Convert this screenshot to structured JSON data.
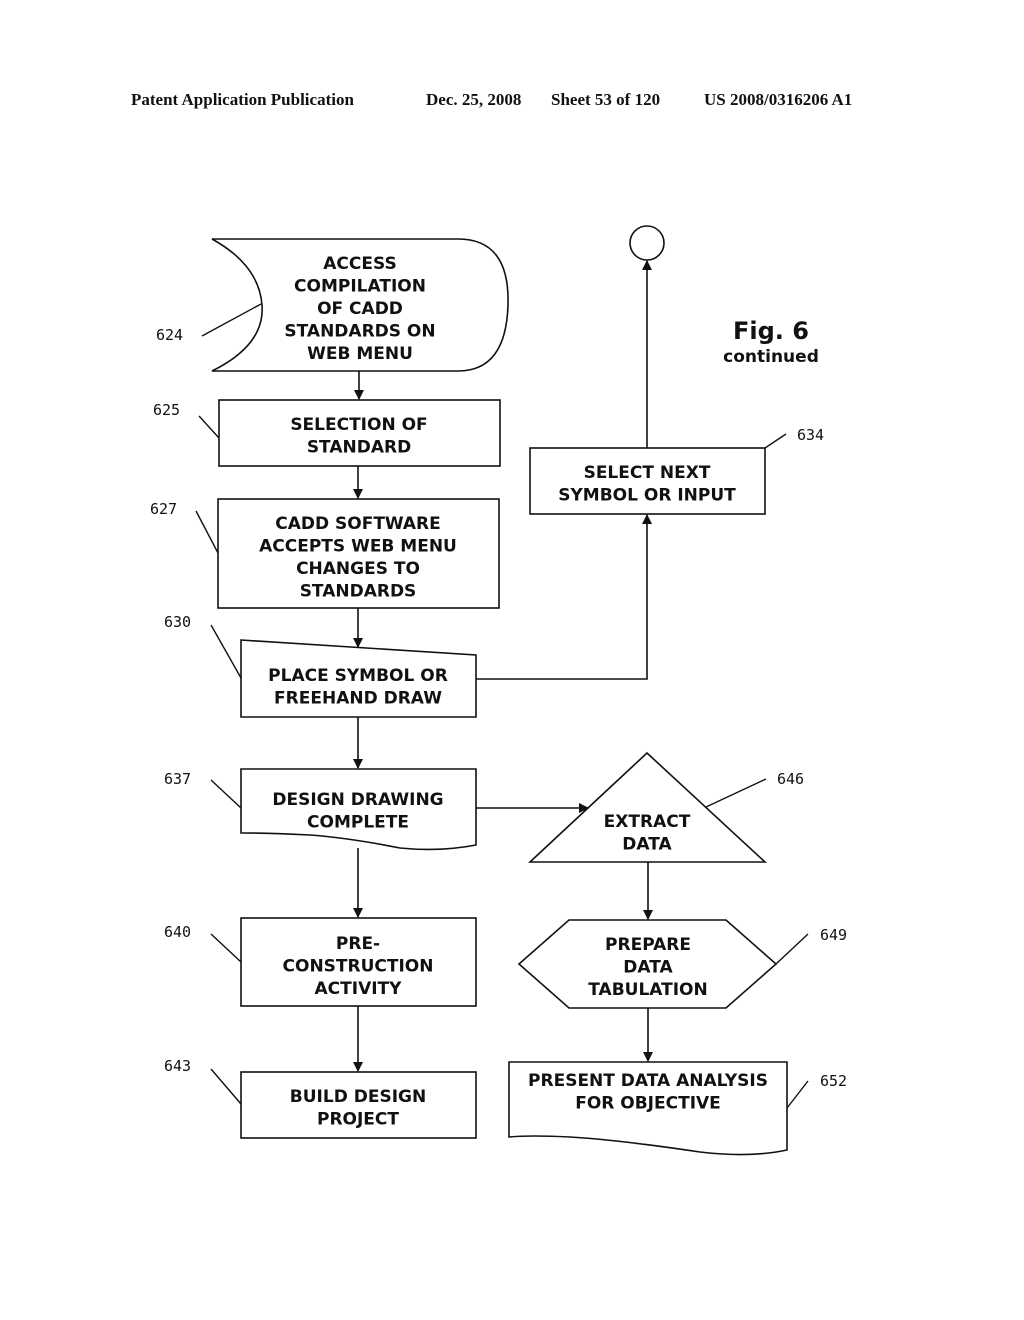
{
  "header": {
    "publication": "Patent Application Publication",
    "date": "Dec. 25, 2008",
    "sheet": "Sheet 53 of 120",
    "number": "US 2008/0316206 A1"
  },
  "figure": {
    "title": "Fig. 6",
    "subtitle": "continued"
  },
  "nodes": {
    "n624": {
      "ref": "624",
      "shape": "stored-data",
      "lines": [
        "ACCESS",
        "COMPILATION",
        "OF CADD",
        "STANDARDS ON",
        "WEB MENU"
      ]
    },
    "n625": {
      "ref": "625",
      "shape": "process",
      "lines": [
        "SELECTION OF",
        "STANDARD"
      ]
    },
    "n627": {
      "ref": "627",
      "shape": "process",
      "lines": [
        "CADD SOFTWARE",
        "ACCEPTS WEB MENU",
        "CHANGES TO",
        "STANDARDS"
      ]
    },
    "n630": {
      "ref": "630",
      "shape": "manual-input",
      "lines": [
        "PLACE SYMBOL OR",
        "FREEHAND DRAW"
      ]
    },
    "n634": {
      "ref": "634",
      "shape": "process",
      "lines": [
        "SELECT NEXT",
        "SYMBOL OR INPUT"
      ]
    },
    "n637": {
      "ref": "637",
      "shape": "document",
      "lines": [
        "DESIGN DRAWING",
        "COMPLETE"
      ]
    },
    "n640": {
      "ref": "640",
      "shape": "process",
      "lines": [
        "PRE-",
        "CONSTRUCTION",
        "ACTIVITY"
      ]
    },
    "n643": {
      "ref": "643",
      "shape": "process",
      "lines": [
        "BUILD DESIGN",
        "PROJECT"
      ]
    },
    "n646": {
      "ref": "646",
      "shape": "extract",
      "lines": [
        "EXTRACT",
        "DATA"
      ]
    },
    "n649": {
      "ref": "649",
      "shape": "preparation",
      "lines": [
        "PREPARE",
        "DATA",
        "TABULATION"
      ]
    },
    "n652": {
      "ref": "652",
      "shape": "document",
      "lines": [
        "PRESENT DATA ANALYSIS",
        "FOR OBJECTIVE"
      ]
    }
  },
  "connector": {
    "shape": "on-page-connector",
    "label": ""
  },
  "edges": [
    {
      "from": "624",
      "to": "625"
    },
    {
      "from": "625",
      "to": "627"
    },
    {
      "from": "627",
      "to": "630"
    },
    {
      "from": "630",
      "to": "634"
    },
    {
      "from": "634",
      "to": "connector"
    },
    {
      "from": "630",
      "to": "637"
    },
    {
      "from": "637",
      "to": "646"
    },
    {
      "from": "637",
      "to": "640"
    },
    {
      "from": "640",
      "to": "643"
    },
    {
      "from": "646",
      "to": "649"
    },
    {
      "from": "649",
      "to": "652"
    }
  ]
}
